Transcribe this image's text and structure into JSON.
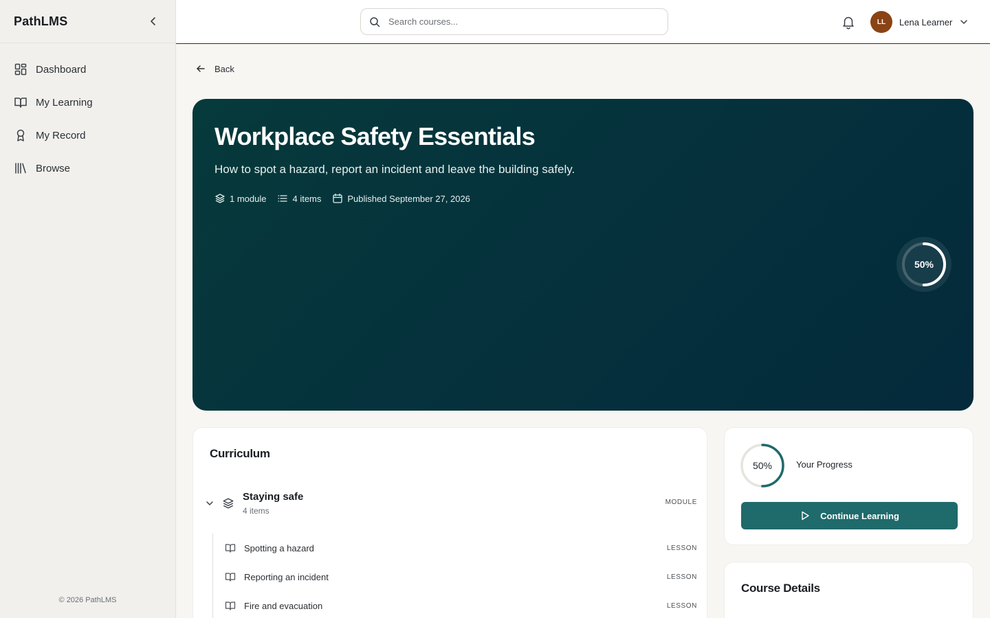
{
  "app": {
    "brand": "PathLMS",
    "footer": "© 2026 PathLMS"
  },
  "sidebar": {
    "items": [
      {
        "label": "Dashboard",
        "icon": "dashboard-icon"
      },
      {
        "label": "My Learning",
        "icon": "book-open-icon"
      },
      {
        "label": "My Record",
        "icon": "award-icon"
      },
      {
        "label": "Browse",
        "icon": "library-icon"
      }
    ]
  },
  "topbar": {
    "search_placeholder": "Search courses...",
    "user": {
      "initials": "LL",
      "name": "Lena Learner",
      "avatar_color": "#8a4314"
    }
  },
  "main": {
    "back_label": "Back",
    "course": {
      "title": "Workplace Safety Essentials",
      "subtitle": "How to spot a hazard, report an incident and leave the building safely.",
      "meta": {
        "modules": "1 module",
        "items": "4 items",
        "published": "Published September 27, 2026"
      },
      "progress_label": "50%",
      "progress_fraction": 0.5
    },
    "curriculum": {
      "title": "Curriculum",
      "modules": [
        {
          "name": "Staying safe",
          "count": "4 items",
          "tag": "MODULE",
          "lessons": [
            {
              "name": "Spotting a hazard",
              "tag": "LESSON"
            },
            {
              "name": "Reporting an incident",
              "tag": "LESSON"
            },
            {
              "name": "Fire and evacuation",
              "tag": "LESSON"
            }
          ]
        }
      ]
    },
    "progress_card": {
      "percent_label": "50%",
      "progress_fraction": 0.5,
      "label": "Your Progress",
      "button_label": "Continue Learning"
    },
    "details_card": {
      "title": "Course Details"
    }
  },
  "colors": {
    "hero_bg": "#05323c",
    "accent": "#1f6a6b",
    "sidebar_bg": "#f1f0ed"
  }
}
